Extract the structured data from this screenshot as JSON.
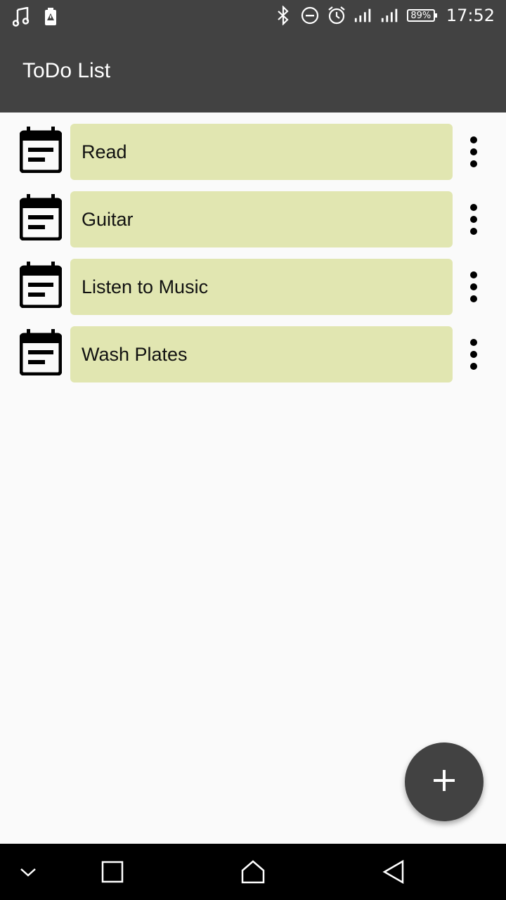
{
  "status_bar": {
    "icons_left": [
      "music-note-icon",
      "battery-warning-icon"
    ],
    "icons_right": [
      "bluetooth-icon",
      "do-not-disturb-icon",
      "alarm-icon",
      "signal-icon",
      "signal-icon"
    ],
    "battery": "89%",
    "time": "17:52"
  },
  "app_bar": {
    "title": "ToDo List"
  },
  "todos": [
    {
      "label": "Read"
    },
    {
      "label": "Guitar"
    },
    {
      "label": "Listen to Music"
    },
    {
      "label": "Wash Plates"
    }
  ],
  "fab": {
    "icon": "plus-icon"
  },
  "nav_bar": {
    "icons": [
      "chevron-down-icon",
      "recents-icon",
      "home-icon",
      "back-icon"
    ]
  },
  "colors": {
    "app_bar": "#424242",
    "card": "#e1e6b1",
    "fab": "#424242",
    "background": "#fafafa"
  }
}
